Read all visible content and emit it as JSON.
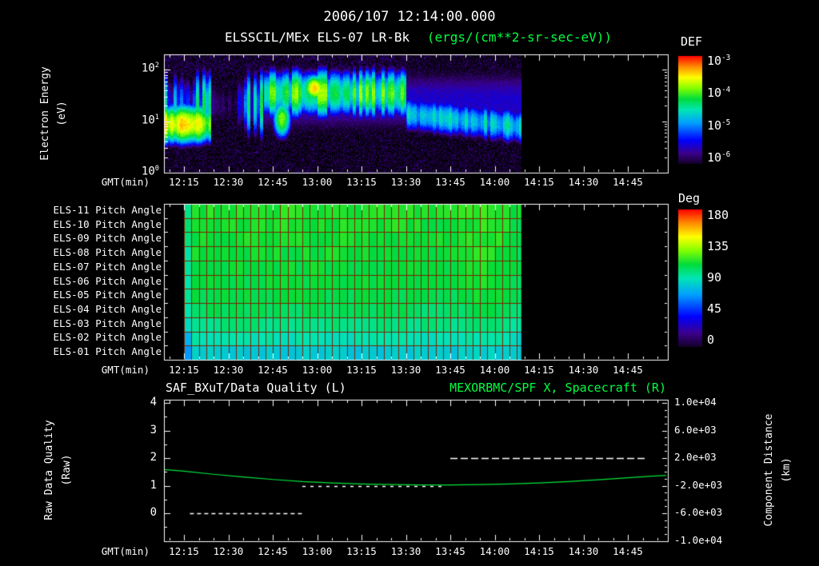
{
  "title": "2006/107 12:14:00.000",
  "colors": {
    "background": "#000000",
    "text": "#ffffff",
    "accent_green": "#00ff41",
    "grid_red": "#7a2400",
    "curve_green": "#00e63c"
  },
  "colormap": [
    {
      "v": 0.0,
      "c": "#140028"
    },
    {
      "v": 0.1,
      "c": "#3c008c"
    },
    {
      "v": 0.22,
      "c": "#0000ff"
    },
    {
      "v": 0.38,
      "c": "#00a0ff"
    },
    {
      "v": 0.5,
      "c": "#00e6b4"
    },
    {
      "v": 0.6,
      "c": "#00dc3c"
    },
    {
      "v": 0.7,
      "c": "#82ff00"
    },
    {
      "v": 0.8,
      "c": "#ffff00"
    },
    {
      "v": 0.9,
      "c": "#ff8c00"
    },
    {
      "v": 1.0,
      "c": "#ff0000"
    }
  ],
  "axes": {
    "time_label": "GMT(min)",
    "time_ticks": [
      "12:15",
      "12:30",
      "12:45",
      "13:00",
      "13:15",
      "13:30",
      "13:45",
      "14:00",
      "14:15",
      "14:30",
      "14:45"
    ],
    "time_range": [
      "12:08",
      "14:58"
    ]
  },
  "top_panel": {
    "title": "ELSSCIL/MEx ELS-07 LR-Bk",
    "units": "(ergs/(cm**2-sr-sec-eV))",
    "ylabel_line1": "Electron Energy",
    "ylabel_line2": "(eV)",
    "yticks": [
      "10^2",
      "10^1",
      "10^0"
    ],
    "colorbar": {
      "label": "DEF",
      "ticks": [
        "10^-3",
        "10^-4",
        "10^-5",
        "10^-6"
      ]
    }
  },
  "middle_panel": {
    "row_labels": [
      "ELS-11 Pitch Angle",
      "ELS-10 Pitch Angle",
      "ELS-09 Pitch Angle",
      "ELS-08 Pitch Angle",
      "ELS-07 Pitch Angle",
      "ELS-06 Pitch Angle",
      "ELS-05 Pitch Angle",
      "ELS-04 Pitch Angle",
      "ELS-03 Pitch Angle",
      "ELS-02 Pitch Angle",
      "ELS-01 Pitch Angle"
    ],
    "colorbar": {
      "label": "Deg",
      "ticks": [
        "180",
        "135",
        "90",
        "45",
        "0"
      ]
    }
  },
  "bottom_panel": {
    "title_left": "SAF_BXuT/Data Quality (L)",
    "title_right": "MEXORBMC/SPF X, Spacecraft (R)",
    "ylabel_left_line1": "Raw Data Quality",
    "ylabel_left_line2": "(Raw)",
    "ylabel_right_line1": "Component Distance",
    "ylabel_right_line2": "(km)",
    "yticks_left": [
      "4",
      "3",
      "2",
      "1",
      "0"
    ],
    "yticks_right": [
      "1.0e+04",
      "6.0e+03",
      "2.0e+03",
      "-2.0e+03",
      "-6.0e+03",
      "-1.0e+04"
    ]
  },
  "chart_data": [
    {
      "id": "electron-energy-spectrogram",
      "type": "heatmap",
      "title": "ELSSCIL/MEx ELS-07 LR-Bk",
      "value_units": "ergs/(cm**2-sr-sec-eV)",
      "colorbar": {
        "label": "DEF",
        "log10_range": [
          -6,
          -3
        ]
      },
      "x": {
        "label": "GMT(min)",
        "range": [
          "12:08",
          "14:58"
        ],
        "ticks": [
          "12:15",
          "12:30",
          "12:45",
          "13:00",
          "13:15",
          "13:30",
          "13:45",
          "14:00",
          "14:15",
          "14:30",
          "14:45"
        ]
      },
      "y": {
        "label": "Electron Energy (eV)",
        "scale": "log",
        "range": [
          1,
          200
        ]
      },
      "data_extent": {
        "start": "12:08",
        "end": "14:09"
      },
      "features": [
        {
          "name": "background",
          "log10_def": -6.15,
          "noise": 0.45
        },
        {
          "name": "low-energy-beam",
          "t_start": "12:08",
          "t_end": "12:24",
          "logE_center": 0.95,
          "logE_sigma": 0.3,
          "log10_def": -3.6,
          "decay_from": "12:20",
          "decay_per_min": 0.12,
          "column_noise": 0.2
        },
        {
          "name": "foreshock-patchy",
          "t_start": "12:08",
          "t_end": "12:42",
          "logE_center": 1.35,
          "logE_sigma": 0.55,
          "log10_def": -4.9,
          "column_noise": 0.75
        },
        {
          "name": "dropout-gap",
          "t_start": "12:24",
          "t_end": "12:33",
          "log10_delta": -1.3
        },
        {
          "name": "sheath-turbulence",
          "t_start": "12:42",
          "t_end": "13:30",
          "logE_center": 1.55,
          "logE_sigma": 0.38,
          "log10_def": -4.25,
          "column_noise": 0.5
        },
        {
          "name": "bright-spot",
          "t_center": "12:59",
          "t_sigma_min": 3,
          "logE_center": 1.65,
          "logE_sigma": 0.2,
          "log10_def": -3.45
        },
        {
          "name": "low-energy-blob",
          "t_center": "12:48",
          "t_sigma_min": 2.5,
          "logE_center": 1.05,
          "logE_sigma": 0.3,
          "log10_def": -3.9
        },
        {
          "name": "tail-band",
          "t_start": "13:30",
          "t_end": "14:09",
          "logE_center": 1.15,
          "logE_center_end": 0.9,
          "logE_sigma": 0.3,
          "log10_def": -4.7,
          "column_noise": 0.3
        },
        {
          "name": "diffuse-halo",
          "t_start": "12:42",
          "t_end": "14:09",
          "logE_center": 1.4,
          "logE_sigma": 0.75,
          "log10_def": -5.5
        }
      ]
    },
    {
      "id": "pitch-angle-panels",
      "type": "heatmap",
      "rows": [
        "ELS-11",
        "ELS-10",
        "ELS-09",
        "ELS-08",
        "ELS-07",
        "ELS-06",
        "ELS-05",
        "ELS-04",
        "ELS-03",
        "ELS-02",
        "ELS-01"
      ],
      "value_units": "Deg",
      "value_range": [
        0,
        180
      ],
      "data_extent": {
        "start": "12:15",
        "end": "14:09"
      },
      "cell_minutes": 2.5,
      "row_mean_deg": [
        112,
        111,
        110,
        109,
        108,
        107,
        106,
        103,
        98,
        90,
        82
      ],
      "noise_deg": 3.5,
      "time_effects": [
        {
          "name": "first-column-dip",
          "t_start": "12:15",
          "t_end": "12:18",
          "delta_deg": -14
        },
        {
          "name": "late-cyan-drift",
          "t_start": "13:30",
          "t_end": "14:08",
          "delta_deg_end": -7
        },
        {
          "name": "bright-green-band",
          "t_center": "13:58",
          "t_sigma_min": 7,
          "delta_deg": 8
        }
      ]
    },
    {
      "id": "quality-and-distance",
      "type": "line",
      "x": {
        "label": "GMT(min)",
        "range": [
          "12:08",
          "14:58"
        ]
      },
      "left_axis": {
        "label": "Raw Data Quality (Raw)",
        "range": [
          -1,
          4
        ],
        "ticks": [
          4,
          3,
          2,
          1,
          0
        ]
      },
      "right_axis": {
        "label": "Component Distance (km)",
        "range": [
          -10000,
          10000
        ],
        "ticks": [
          10000,
          6000,
          2000,
          -2000,
          -6000,
          -10000
        ]
      },
      "series": [
        {
          "name": "SAF_BXuT/Data Quality",
          "axis": "left",
          "color": "#ffffff",
          "style": "dashed",
          "segments": [
            {
              "t_start": "12:17",
              "t_end": "12:55",
              "value": 0
            },
            {
              "t_start": "12:55",
              "t_end": "13:43",
              "value": 1
            },
            {
              "t_start": "13:45",
              "t_end": "14:51",
              "value": 2
            }
          ]
        },
        {
          "name": "MEXORBMC/SPF X Spacecraft",
          "axis": "right",
          "color": "#00e63c",
          "style": "solid",
          "points_t": [
            "12:08",
            "12:15",
            "12:25",
            "12:35",
            "12:45",
            "12:55",
            "13:05",
            "13:15",
            "13:25",
            "13:35",
            "13:45",
            "13:55",
            "14:05",
            "14:15",
            "14:25",
            "14:35",
            "14:45",
            "14:52",
            "14:58"
          ],
          "points_km": [
            350,
            100,
            -350,
            -750,
            -1100,
            -1400,
            -1600,
            -1750,
            -1850,
            -1900,
            -1900,
            -1850,
            -1750,
            -1600,
            -1400,
            -1150,
            -850,
            -650,
            -500
          ]
        }
      ]
    }
  ]
}
